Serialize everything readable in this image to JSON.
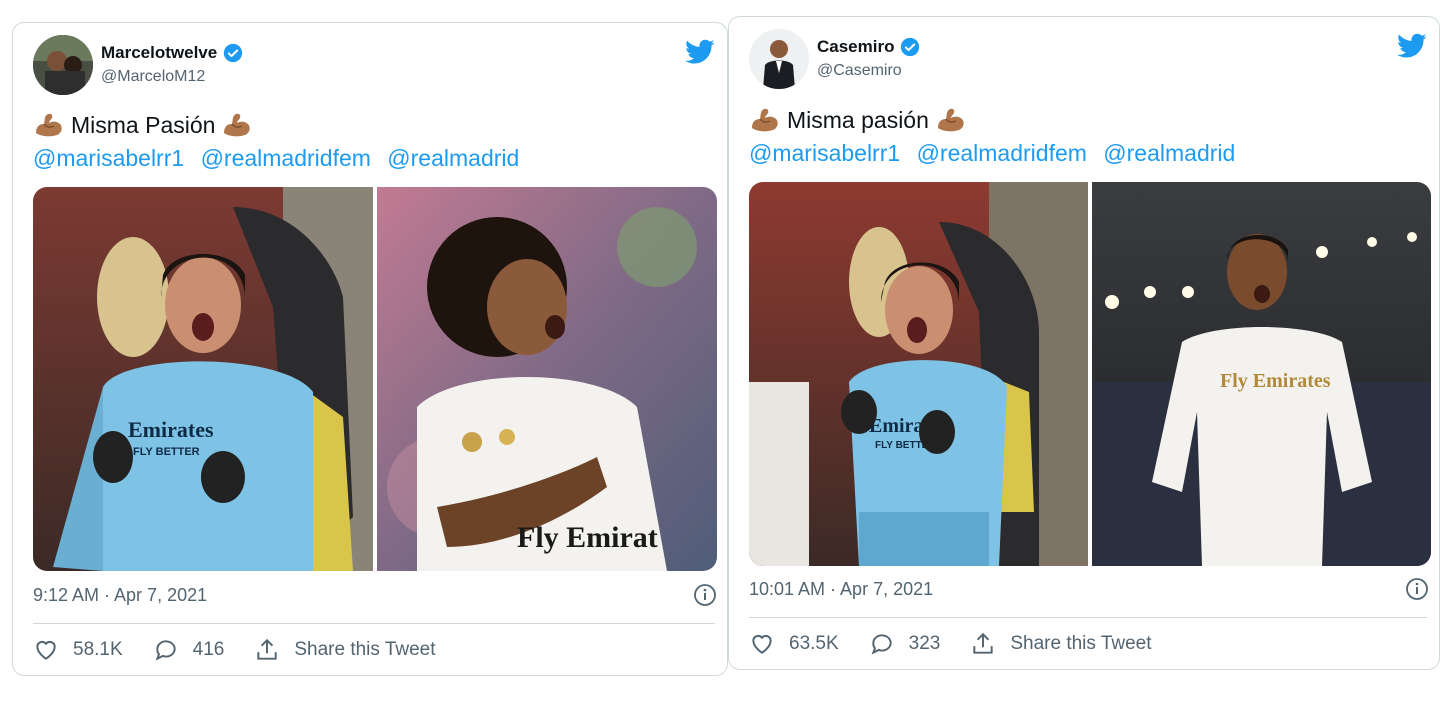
{
  "tweets": [
    {
      "display_name": "Marcelotwelve",
      "handle": "@MarceloM12",
      "text": "Misma Pasión",
      "mentions": [
        "@marisabelrr1",
        "@realmadridfem",
        "@realmadrid"
      ],
      "timestamp": "9:12 AM · Apr 7, 2021",
      "likes": "58.1K",
      "replies": "416",
      "share_label": "Share this Tweet",
      "jersey_text_1": "Emirates",
      "jersey_text_2": "FLY BETTER",
      "photo2_jersey_text": "Fly Emirat"
    },
    {
      "display_name": "Casemiro",
      "handle": "@Casemiro",
      "text": "Misma pasión",
      "mentions": [
        "@marisabelrr1",
        "@realmadridfem",
        "@realmadrid"
      ],
      "timestamp": "10:01 AM · Apr 7, 2021",
      "likes": "63.5K",
      "replies": "323",
      "share_label": "Share this Tweet",
      "jersey_text_1": "Emirates",
      "jersey_text_2": "FLY BETTER",
      "photo2_jersey_text": "Fly Emirates"
    }
  ],
  "colors": {
    "twitter_blue": "#1d9bf0",
    "text_primary": "#0f1419",
    "text_secondary": "#536471",
    "border": "#cfd9de",
    "keeper_jersey": "#7ec3e6",
    "madrid_white": "#f4f2ee"
  },
  "icons": [
    "verified-badge-icon",
    "twitter-bird-icon",
    "flexed-biceps-emoji",
    "info-icon",
    "heart-icon",
    "reply-icon",
    "share-icon"
  ]
}
